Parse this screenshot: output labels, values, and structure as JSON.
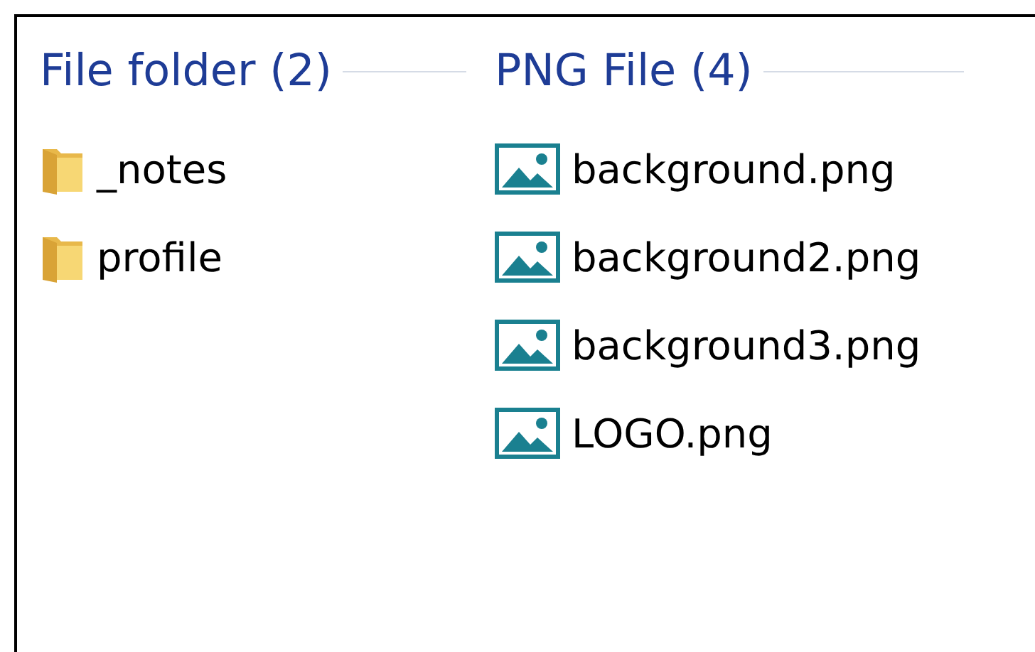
{
  "groups": [
    {
      "title": "File folder (2)",
      "items": [
        {
          "name": "_notes",
          "kind": "folder"
        },
        {
          "name": "profile",
          "kind": "folder"
        }
      ]
    },
    {
      "title": "PNG File (4)",
      "items": [
        {
          "name": "background.png",
          "kind": "image"
        },
        {
          "name": "background2.png",
          "kind": "image"
        },
        {
          "name": "background3.png",
          "kind": "image"
        },
        {
          "name": "LOGO.png",
          "kind": "image"
        }
      ]
    }
  ]
}
